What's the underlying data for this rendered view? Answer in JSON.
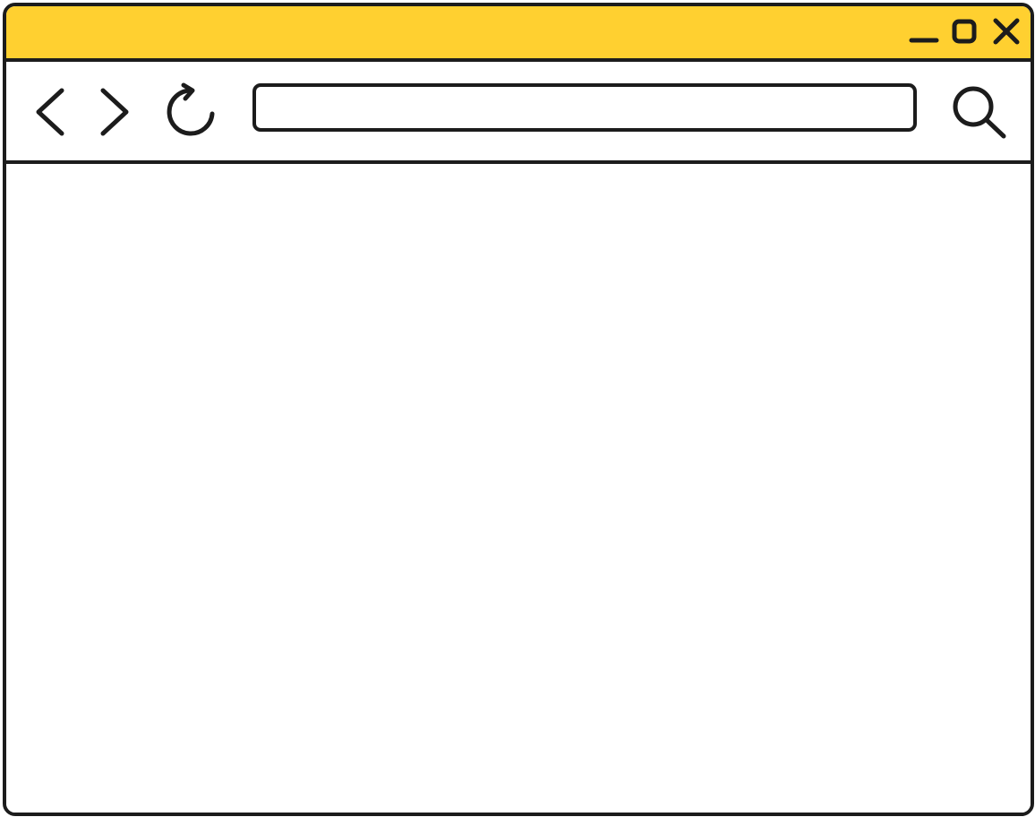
{
  "window": {
    "accent_color": "#FFD030",
    "border_color": "#1C1C1C",
    "background_color": "#FFFFFF"
  },
  "title_bar": {
    "controls": [
      {
        "name": "minimize",
        "icon": "minimize-icon"
      },
      {
        "name": "maximize",
        "icon": "maximize-icon"
      },
      {
        "name": "close",
        "icon": "close-icon"
      }
    ]
  },
  "toolbar": {
    "buttons": [
      {
        "name": "back",
        "icon": "chevron-left-icon"
      },
      {
        "name": "forward",
        "icon": "chevron-right-icon"
      },
      {
        "name": "reload",
        "icon": "reload-icon"
      },
      {
        "name": "search",
        "icon": "search-icon"
      }
    ],
    "address_bar": {
      "value": "",
      "placeholder": ""
    }
  },
  "content": {}
}
